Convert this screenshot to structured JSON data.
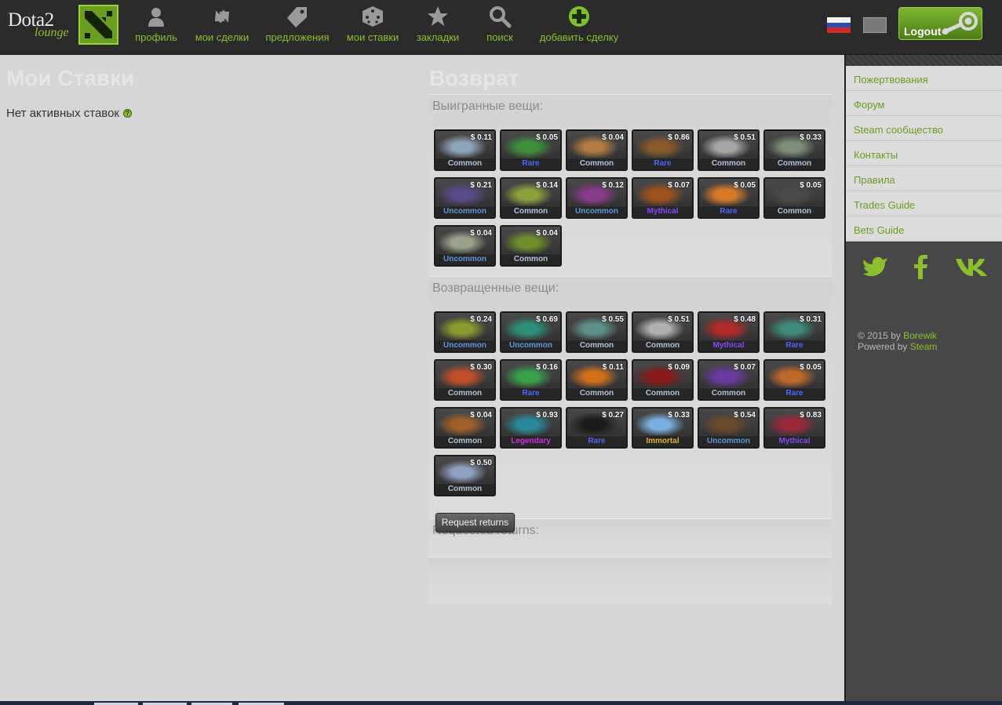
{
  "logo": {
    "word": "Dota2",
    "sub": "lounge"
  },
  "nav": [
    {
      "label": "профиль",
      "icon": "user-icon"
    },
    {
      "label": "мои сделки",
      "icon": "trade-arrows-icon"
    },
    {
      "label": "предложения",
      "icon": "tag-icon"
    },
    {
      "label": "мои ставки",
      "icon": "dice-icon"
    },
    {
      "label": "закладки",
      "icon": "star-icon"
    },
    {
      "label": "поиск",
      "icon": "search-icon"
    },
    {
      "label": "добавить сделку",
      "icon": "plus-circle-icon"
    }
  ],
  "header": {
    "logout_label": "Logout"
  },
  "bets": {
    "title": "Мои Ставки",
    "empty_text": "Нет активных ставок",
    "help_glyph": "?"
  },
  "returns": {
    "title": "Возврат",
    "won_label": "Выигранные вещи:",
    "returned_label": "Возвращенные вещи:",
    "requested_label": "Requested returns:",
    "request_button": "Request returns"
  },
  "rarity_colors": {
    "Common": "#b0c3d9",
    "Uncommon": "#5e98d9",
    "Rare": "#4b69ff",
    "Mythical": "#8847ff",
    "Legendary": "#d32ce6",
    "Immortal": "#e4ae39"
  },
  "won_items": [
    {
      "price": "$ 0.11",
      "rarity": "Common",
      "accent": "#8fa3b8"
    },
    {
      "price": "$ 0.05",
      "rarity": "Rare",
      "accent": "#3f8f3a"
    },
    {
      "price": "$ 0.04",
      "rarity": "Common",
      "accent": "#b07a42"
    },
    {
      "price": "$ 0.86",
      "rarity": "Rare",
      "accent": "#8a5a2a"
    },
    {
      "price": "$ 0.51",
      "rarity": "Common",
      "accent": "#a6a6a6"
    },
    {
      "price": "$ 0.33",
      "rarity": "Common",
      "accent": "#7d8f7a"
    },
    {
      "price": "$ 0.21",
      "rarity": "Uncommon",
      "accent": "#5a4a8a"
    },
    {
      "price": "$ 0.14",
      "rarity": "Common",
      "accent": "#8da13a"
    },
    {
      "price": "$ 0.12",
      "rarity": "Uncommon",
      "accent": "#8a3a8a"
    },
    {
      "price": "$ 0.07",
      "rarity": "Mythical",
      "accent": "#a0521e"
    },
    {
      "price": "$ 0.05",
      "rarity": "Rare",
      "accent": "#d8792a"
    },
    {
      "price": "$ 0.05",
      "rarity": "Common",
      "accent": "#4a4a4a"
    },
    {
      "price": "$ 0.04",
      "rarity": "Uncommon",
      "accent": "#9aa38a"
    },
    {
      "price": "$ 0.04",
      "rarity": "Common",
      "accent": "#6f8f2a"
    }
  ],
  "returned_items": [
    {
      "price": "$ 0.24",
      "rarity": "Uncommon",
      "accent": "#8c9a2e"
    },
    {
      "price": "$ 0.69",
      "rarity": "Uncommon",
      "accent": "#2e8f7a"
    },
    {
      "price": "$ 0.55",
      "rarity": "Common",
      "accent": "#5f8f8a"
    },
    {
      "price": "$ 0.51",
      "rarity": "Common",
      "accent": "#b0b0b0"
    },
    {
      "price": "$ 0.48",
      "rarity": "Mythical",
      "accent": "#b02a2a"
    },
    {
      "price": "$ 0.31",
      "rarity": "Rare",
      "accent": "#3f8a7a"
    },
    {
      "price": "$ 0.30",
      "rarity": "Common",
      "accent": "#c0502a"
    },
    {
      "price": "$ 0.16",
      "rarity": "Rare",
      "accent": "#3aa04a"
    },
    {
      "price": "$ 0.11",
      "rarity": "Common",
      "accent": "#d0701a"
    },
    {
      "price": "$ 0.09",
      "rarity": "Common",
      "accent": "#8a1a1a"
    },
    {
      "price": "$ 0.07",
      "rarity": "Common",
      "accent": "#6a3aa0"
    },
    {
      "price": "$ 0.05",
      "rarity": "Rare",
      "accent": "#c06a2a"
    },
    {
      "price": "$ 0.04",
      "rarity": "Common",
      "accent": "#a0602a"
    },
    {
      "price": "$ 0.93",
      "rarity": "Legendary",
      "accent": "#2a8a9a"
    },
    {
      "price": "$ 0.27",
      "rarity": "Rare",
      "accent": "#1a1a1a"
    },
    {
      "price": "$ 0.33",
      "rarity": "Immortal",
      "accent": "#7ab0e0"
    },
    {
      "price": "$ 0.54",
      "rarity": "Uncommon",
      "accent": "#6a4a2a"
    },
    {
      "price": "$ 0.83",
      "rarity": "Mythical",
      "accent": "#9a2a3a"
    },
    {
      "price": "$ 0.50",
      "rarity": "Common",
      "accent": "#8fa0c0"
    }
  ],
  "sidebar": {
    "links": [
      "Пожертвования",
      "Форум",
      "Steam сообщество",
      "Контакты",
      "Правила",
      "Trades Guide",
      "Bets Guide"
    ],
    "footer_prefix": "© 2015 by",
    "footer_author": "Borewik",
    "footer_powered": "Powered by",
    "footer_platform": "Steam"
  }
}
